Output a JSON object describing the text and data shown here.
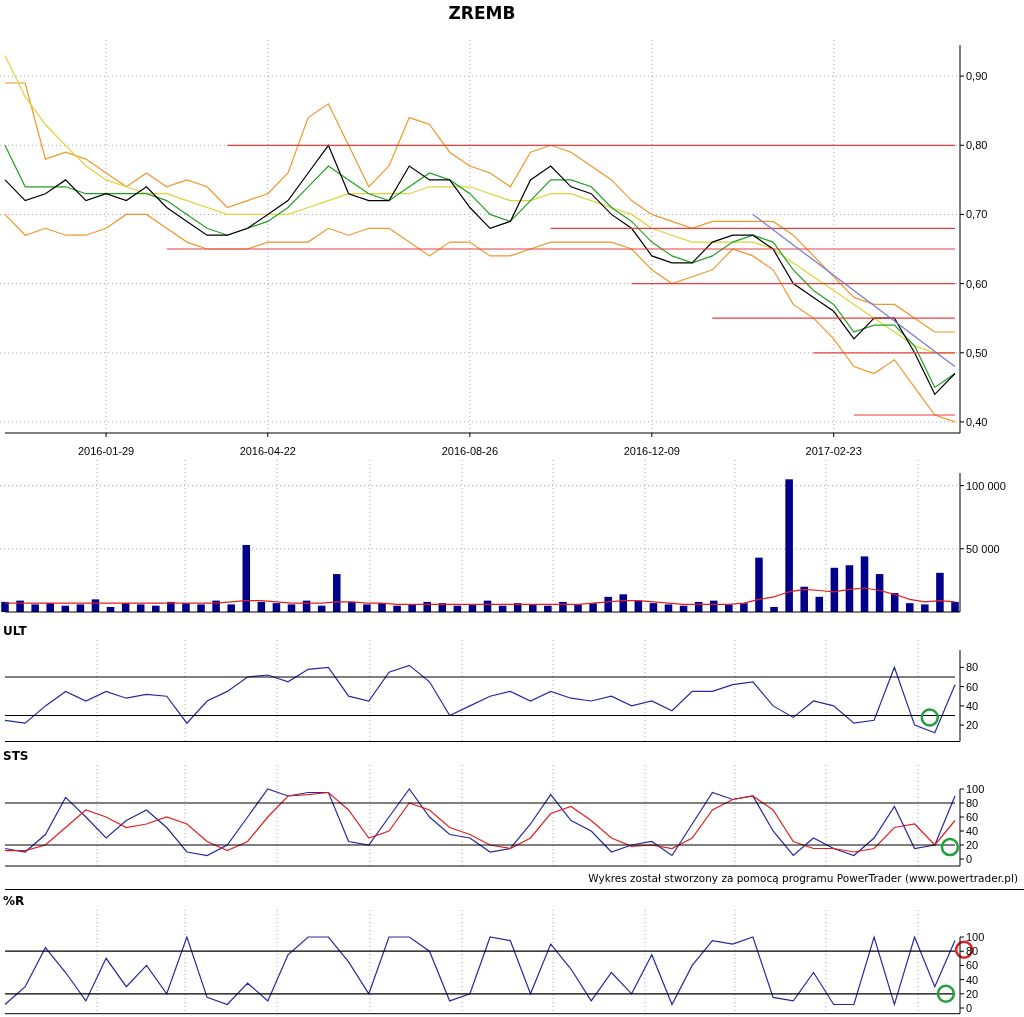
{
  "title": "ZREMB",
  "price_chart": {
    "chart_data": {
      "type": "line",
      "grid": true,
      "ylim": [
        0.384,
        0.945
      ],
      "categories": [
        null,
        null,
        null,
        null,
        null,
        "2016-01-29",
        null,
        null,
        null,
        null,
        null,
        null,
        null,
        "2016-04-22",
        null,
        null,
        null,
        null,
        null,
        null,
        null,
        null,
        null,
        "2016-08-26",
        null,
        null,
        null,
        null,
        null,
        null,
        null,
        null,
        "2016-12-09",
        null,
        null,
        null,
        null,
        null,
        null,
        null,
        null,
        "2017-02-23",
        null,
        null,
        null,
        null,
        null,
        null
      ],
      "yticks": [
        {
          "value": 0.4,
          "label": "0,40"
        },
        {
          "value": 0.5,
          "label": "0,50"
        },
        {
          "value": 0.6,
          "label": "0,60"
        },
        {
          "value": 0.7,
          "label": "0,70"
        },
        {
          "value": 0.8,
          "label": "0,80"
        },
        {
          "value": 0.9,
          "label": "0,90"
        }
      ],
      "series": [
        {
          "color": "#f0962a",
          "values": [
            0.89,
            0.89,
            0.78,
            0.79,
            0.78,
            0.76,
            0.74,
            0.76,
            0.74,
            0.75,
            0.74,
            0.71,
            0.72,
            0.73,
            0.76,
            0.84,
            0.86,
            0.8,
            0.74,
            0.77,
            0.84,
            0.83,
            0.79,
            0.77,
            0.76,
            0.74,
            0.79,
            0.8,
            0.79,
            0.77,
            0.75,
            0.72,
            0.7,
            0.69,
            0.68,
            0.69,
            0.69,
            0.69,
            0.69,
            0.67,
            0.64,
            0.61,
            0.58,
            0.57,
            0.57,
            0.55,
            0.53,
            0.53
          ]
        },
        {
          "color": "#f0962a",
          "values": [
            0.7,
            0.67,
            0.68,
            0.67,
            0.67,
            0.68,
            0.7,
            0.7,
            0.68,
            0.66,
            0.65,
            0.65,
            0.65,
            0.66,
            0.66,
            0.66,
            0.68,
            0.67,
            0.68,
            0.68,
            0.66,
            0.64,
            0.66,
            0.66,
            0.64,
            0.64,
            0.65,
            0.66,
            0.66,
            0.66,
            0.66,
            0.65,
            0.62,
            0.6,
            0.61,
            0.62,
            0.65,
            0.64,
            0.62,
            0.57,
            0.55,
            0.52,
            0.48,
            0.47,
            0.49,
            0.45,
            0.41,
            0.4
          ]
        },
        {
          "color": "#dcd43a",
          "values": [
            0.93,
            0.87,
            0.83,
            0.8,
            0.77,
            0.75,
            0.74,
            0.73,
            0.73,
            0.72,
            0.71,
            0.7,
            0.7,
            0.7,
            0.7,
            0.71,
            0.72,
            0.73,
            0.73,
            0.73,
            0.73,
            0.74,
            0.74,
            0.74,
            0.73,
            0.72,
            0.72,
            0.73,
            0.73,
            0.72,
            0.71,
            0.7,
            0.68,
            0.67,
            0.66,
            0.66,
            0.66,
            0.66,
            0.65,
            0.63,
            0.61,
            0.59,
            0.57,
            0.55,
            0.53,
            0.51,
            0.5,
            0.5
          ]
        },
        {
          "color": "#22a022",
          "values": [
            0.8,
            0.74,
            0.74,
            0.74,
            0.73,
            0.73,
            0.73,
            0.73,
            0.72,
            0.7,
            0.68,
            0.67,
            0.68,
            0.69,
            0.71,
            0.74,
            0.77,
            0.75,
            0.73,
            0.72,
            0.74,
            0.76,
            0.75,
            0.73,
            0.7,
            0.69,
            0.72,
            0.75,
            0.75,
            0.74,
            0.71,
            0.69,
            0.66,
            0.64,
            0.63,
            0.64,
            0.66,
            0.67,
            0.66,
            0.62,
            0.59,
            0.57,
            0.53,
            0.54,
            0.54,
            0.51,
            0.45,
            0.47
          ]
        },
        {
          "color": "#000000",
          "values": [
            0.75,
            0.72,
            0.73,
            0.75,
            0.72,
            0.73,
            0.72,
            0.74,
            0.71,
            0.69,
            0.67,
            0.67,
            0.68,
            0.7,
            0.72,
            0.76,
            0.8,
            0.73,
            0.72,
            0.72,
            0.77,
            0.75,
            0.75,
            0.71,
            0.68,
            0.69,
            0.75,
            0.77,
            0.74,
            0.73,
            0.7,
            0.68,
            0.64,
            0.63,
            0.63,
            0.66,
            0.67,
            0.67,
            0.65,
            0.6,
            0.58,
            0.56,
            0.52,
            0.55,
            0.55,
            0.5,
            0.44,
            0.47
          ]
        },
        {
          "color": "#e84040",
          "values": [
            null,
            null,
            null,
            null,
            null,
            null,
            null,
            null,
            null,
            null,
            null,
            0.8,
            0.8,
            0.8,
            0.8,
            0.8,
            0.8,
            0.8,
            0.8,
            0.8,
            0.8,
            0.8,
            0.8,
            0.8,
            0.8,
            0.8,
            0.8,
            0.8,
            0.8,
            0.8,
            0.8,
            0.8,
            0.8,
            0.8,
            0.8,
            0.8,
            0.8,
            0.8,
            0.8,
            0.8,
            0.8,
            0.8,
            0.8,
            0.8,
            0.8,
            0.8,
            0.8,
            0.8
          ]
        },
        {
          "color": "#e84040",
          "values": [
            null,
            null,
            null,
            null,
            null,
            null,
            null,
            null,
            null,
            null,
            null,
            null,
            null,
            null,
            null,
            null,
            null,
            null,
            null,
            null,
            null,
            null,
            null,
            null,
            null,
            null,
            null,
            0.68,
            0.68,
            0.68,
            0.68,
            0.68,
            0.68,
            0.68,
            0.68,
            0.68,
            0.68,
            0.68,
            0.68,
            0.68,
            0.68,
            0.68,
            0.68,
            0.68,
            0.68,
            0.68,
            0.68,
            0.68
          ]
        },
        {
          "color": "#e84040",
          "values": [
            null,
            null,
            null,
            null,
            null,
            null,
            null,
            null,
            0.65,
            0.65,
            0.65,
            0.65,
            0.65,
            0.65,
            0.65,
            0.65,
            0.65,
            0.65,
            0.65,
            0.65,
            0.65,
            0.65,
            0.65,
            0.65,
            0.65,
            0.65,
            0.65,
            0.65,
            0.65,
            0.65,
            0.65,
            0.65,
            0.65,
            0.65,
            0.65,
            0.65,
            0.65,
            0.65,
            0.65,
            0.65,
            0.65,
            0.65,
            0.65,
            0.65,
            0.65,
            0.65,
            0.65,
            0.65
          ]
        },
        {
          "color": "#e84040",
          "values": [
            null,
            null,
            null,
            null,
            null,
            null,
            null,
            null,
            null,
            null,
            null,
            null,
            null,
            null,
            null,
            null,
            null,
            null,
            null,
            null,
            null,
            null,
            null,
            null,
            null,
            null,
            null,
            null,
            null,
            null,
            null,
            0.6,
            0.6,
            0.6,
            0.6,
            0.6,
            0.6,
            0.6,
            0.6,
            0.6,
            0.6,
            0.6,
            0.6,
            0.6,
            0.6,
            0.6,
            0.6,
            0.6
          ]
        },
        {
          "color": "#e84040",
          "values": [
            null,
            null,
            null,
            null,
            null,
            null,
            null,
            null,
            null,
            null,
            null,
            null,
            null,
            null,
            null,
            null,
            null,
            null,
            null,
            null,
            null,
            null,
            null,
            null,
            null,
            null,
            null,
            null,
            null,
            null,
            null,
            null,
            null,
            null,
            null,
            0.55,
            0.55,
            0.55,
            0.55,
            0.55,
            0.55,
            0.55,
            0.55,
            0.55,
            0.55,
            0.55,
            0.55,
            0.55
          ]
        },
        {
          "color": "#e84040",
          "values": [
            null,
            null,
            null,
            null,
            null,
            null,
            null,
            null,
            null,
            null,
            null,
            null,
            null,
            null,
            null,
            null,
            null,
            null,
            null,
            null,
            null,
            null,
            null,
            null,
            null,
            null,
            null,
            null,
            null,
            null,
            null,
            null,
            null,
            null,
            null,
            null,
            null,
            null,
            null,
            null,
            0.5,
            0.5,
            0.5,
            0.5,
            0.5,
            0.5,
            0.5,
            0.5
          ]
        },
        {
          "color": "#e84040",
          "values": [
            null,
            null,
            null,
            null,
            null,
            null,
            null,
            null,
            null,
            null,
            null,
            null,
            null,
            null,
            null,
            null,
            null,
            null,
            null,
            null,
            null,
            null,
            null,
            null,
            null,
            null,
            null,
            null,
            null,
            null,
            null,
            null,
            null,
            null,
            null,
            null,
            null,
            null,
            null,
            null,
            null,
            null,
            0.41,
            0.41,
            0.41,
            0.41,
            0.41,
            0.41
          ]
        },
        {
          "color": "#7878d0",
          "values": [
            null,
            null,
            null,
            null,
            null,
            null,
            null,
            null,
            null,
            null,
            null,
            null,
            null,
            null,
            null,
            null,
            null,
            null,
            null,
            null,
            null,
            null,
            null,
            null,
            null,
            null,
            null,
            null,
            null,
            null,
            null,
            null,
            null,
            null,
            null,
            null,
            null,
            0.7,
            0.678,
            0.656,
            0.634,
            0.612,
            0.59,
            0.568,
            0.546,
            0.524,
            0.502,
            0.48
          ]
        }
      ]
    }
  },
  "volume_chart": {
    "chart_data": {
      "type": "bar",
      "grid": true,
      "ylim": [
        0,
        110000
      ],
      "yticks": [
        {
          "value": 50000,
          "label": "50 000"
        },
        {
          "value": 100000,
          "label": "100 000"
        }
      ],
      "series": [
        {
          "color": "#00008b",
          "values": [
            8000,
            9000,
            6000,
            7000,
            5000,
            6000,
            10000,
            4000,
            7000,
            6000,
            5000,
            8000,
            7000,
            6000,
            9000,
            6000,
            53000,
            8000,
            7000,
            6000,
            9000,
            5000,
            30000,
            8000,
            6000,
            7000,
            5000,
            6000,
            8000,
            7000,
            5000,
            6000,
            9000,
            5000,
            7000,
            6000,
            5000,
            8000,
            6000,
            7000,
            12000,
            14000,
            9000,
            7000,
            6000,
            5000,
            8000,
            9000,
            6000,
            7000,
            43000,
            4000,
            105000,
            20000,
            12000,
            35000,
            37000,
            44000,
            30000,
            15000,
            7000,
            6000,
            31000,
            8000
          ]
        },
        {
          "type": "line",
          "color": "#e02020",
          "values": [
            7000,
            7000,
            7000,
            7000,
            7000,
            7000,
            7000,
            7000,
            7000,
            7000,
            7000,
            7000,
            7000,
            7000,
            7000,
            8000,
            9000,
            9000,
            8000,
            7000,
            7000,
            7000,
            8000,
            8000,
            7000,
            7000,
            6000,
            6000,
            6000,
            6000,
            6000,
            6000,
            6000,
            6000,
            6000,
            6000,
            6000,
            6000,
            6000,
            7000,
            8000,
            9000,
            9000,
            8000,
            7000,
            6000,
            6000,
            6000,
            6000,
            7000,
            10000,
            12000,
            16000,
            18000,
            17000,
            16000,
            18000,
            19000,
            17000,
            14000,
            10000,
            8000,
            9000,
            8000
          ]
        }
      ]
    }
  },
  "ult": {
    "label": "ULT",
    "highlights": [
      {
        "color": "#22a040"
      }
    ],
    "chart_data": {
      "type": "line",
      "grid": true,
      "ylim": [
        3,
        98
      ],
      "yticks": [
        {
          "value": 20,
          "label": "20"
        },
        {
          "value": 40,
          "label": "40"
        },
        {
          "value": 60,
          "label": "60"
        },
        {
          "value": 80,
          "label": "80"
        }
      ],
      "series": [
        {
          "color": "#2828a0",
          "values": [
            25,
            22,
            40,
            55,
            45,
            55,
            48,
            52,
            50,
            22,
            45,
            55,
            70,
            72,
            65,
            78,
            80,
            50,
            45,
            75,
            82,
            65,
            30,
            40,
            50,
            55,
            45,
            55,
            48,
            45,
            50,
            40,
            45,
            35,
            55,
            55,
            62,
            65,
            40,
            28,
            45,
            40,
            22,
            25,
            80,
            20,
            12,
            62
          ]
        },
        {
          "color": "#000000",
          "values": [
            70,
            70,
            70,
            70,
            70,
            70,
            70,
            70,
            70,
            70,
            70,
            70,
            70,
            70,
            70,
            70,
            70,
            70,
            70,
            70,
            70,
            70,
            70,
            70,
            70,
            70,
            70,
            70,
            70,
            70,
            70,
            70,
            70,
            70,
            70,
            70,
            70,
            70,
            70,
            70,
            70,
            70,
            70,
            70,
            70,
            70,
            70,
            70
          ]
        },
        {
          "color": "#000000",
          "values": [
            30,
            30,
            30,
            30,
            30,
            30,
            30,
            30,
            30,
            30,
            30,
            30,
            30,
            30,
            30,
            30,
            30,
            30,
            30,
            30,
            30,
            30,
            30,
            30,
            30,
            30,
            30,
            30,
            30,
            30,
            30,
            30,
            30,
            30,
            30,
            30,
            30,
            30,
            30,
            30,
            30,
            30,
            30,
            30,
            30,
            30,
            30,
            30
          ]
        }
      ]
    }
  },
  "sts": {
    "label": "STS",
    "highlights": [
      {
        "color": "#22a040"
      }
    ],
    "chart_data": {
      "type": "line",
      "grid": true,
      "ylim": [
        -10,
        100
      ],
      "yticks": [
        {
          "value": 0,
          "label": "0"
        },
        {
          "value": 20,
          "label": "20"
        },
        {
          "value": 40,
          "label": "40"
        },
        {
          "value": 60,
          "label": "60"
        },
        {
          "value": 80,
          "label": "80"
        },
        {
          "value": 100,
          "label": "100"
        }
      ],
      "series": [
        {
          "color": "#2828a0",
          "values": [
            15,
            10,
            35,
            88,
            60,
            30,
            55,
            70,
            45,
            10,
            5,
            20,
            60,
            100,
            90,
            95,
            95,
            25,
            20,
            60,
            100,
            60,
            35,
            30,
            10,
            15,
            50,
            92,
            55,
            40,
            10,
            20,
            25,
            5,
            50,
            95,
            85,
            90,
            40,
            5,
            30,
            15,
            5,
            30,
            75,
            15,
            20,
            90
          ]
        },
        {
          "color": "#e02020",
          "values": [
            12,
            12,
            20,
            45,
            70,
            60,
            45,
            50,
            60,
            50,
            25,
            12,
            25,
            60,
            90,
            92,
            95,
            70,
            30,
            40,
            80,
            70,
            45,
            35,
            20,
            15,
            30,
            65,
            75,
            55,
            30,
            18,
            20,
            15,
            30,
            70,
            85,
            90,
            70,
            25,
            15,
            15,
            10,
            15,
            45,
            50,
            20,
            55
          ]
        },
        {
          "color": "#000000",
          "values": [
            80,
            80,
            80,
            80,
            80,
            80,
            80,
            80,
            80,
            80,
            80,
            80,
            80,
            80,
            80,
            80,
            80,
            80,
            80,
            80,
            80,
            80,
            80,
            80,
            80,
            80,
            80,
            80,
            80,
            80,
            80,
            80,
            80,
            80,
            80,
            80,
            80,
            80,
            80,
            80,
            80,
            80,
            80,
            80,
            80,
            80,
            80,
            80
          ]
        },
        {
          "color": "#000000",
          "values": [
            20,
            20,
            20,
            20,
            20,
            20,
            20,
            20,
            20,
            20,
            20,
            20,
            20,
            20,
            20,
            20,
            20,
            20,
            20,
            20,
            20,
            20,
            20,
            20,
            20,
            20,
            20,
            20,
            20,
            20,
            20,
            20,
            20,
            20,
            20,
            20,
            20,
            20,
            20,
            20,
            20,
            20,
            20,
            20,
            20,
            20,
            20,
            20
          ]
        }
      ]
    }
  },
  "credit": "Wykres został stworzony za pomocą programu PowerTrader (www.powertrader.pl)",
  "williams_r": {
    "label": "%R",
    "highlights": [
      {
        "color": "#22a040"
      },
      {
        "color": "#e02020"
      }
    ],
    "chart_data": {
      "type": "line",
      "grid": true,
      "ylim": [
        -8,
        100
      ],
      "yticks": [
        {
          "value": 0,
          "label": "0"
        },
        {
          "value": 20,
          "label": "20"
        },
        {
          "value": 40,
          "label": "40"
        },
        {
          "value": 60,
          "label": "60"
        },
        {
          "value": 80,
          "label": "80"
        },
        {
          "value": 100,
          "label": "100"
        }
      ],
      "series": [
        {
          "color": "#2828a0",
          "values": [
            5,
            30,
            85,
            50,
            10,
            70,
            30,
            60,
            20,
            100,
            15,
            5,
            35,
            10,
            75,
            100,
            100,
            65,
            20,
            100,
            100,
            80,
            10,
            20,
            100,
            95,
            20,
            90,
            55,
            10,
            50,
            20,
            75,
            5,
            60,
            95,
            90,
            100,
            15,
            10,
            50,
            5,
            5,
            100,
            5,
            100,
            30,
            95
          ]
        },
        {
          "color": "#000000",
          "values": [
            80,
            80,
            80,
            80,
            80,
            80,
            80,
            80,
            80,
            80,
            80,
            80,
            80,
            80,
            80,
            80,
            80,
            80,
            80,
            80,
            80,
            80,
            80,
            80,
            80,
            80,
            80,
            80,
            80,
            80,
            80,
            80,
            80,
            80,
            80,
            80,
            80,
            80,
            80,
            80,
            80,
            80,
            80,
            80,
            80,
            80,
            80,
            80
          ]
        },
        {
          "color": "#000000",
          "values": [
            20,
            20,
            20,
            20,
            20,
            20,
            20,
            20,
            20,
            20,
            20,
            20,
            20,
            20,
            20,
            20,
            20,
            20,
            20,
            20,
            20,
            20,
            20,
            20,
            20,
            20,
            20,
            20,
            20,
            20,
            20,
            20,
            20,
            20,
            20,
            20,
            20,
            20,
            20,
            20,
            20,
            20,
            20,
            20,
            20,
            20,
            20,
            20
          ]
        }
      ]
    }
  }
}
